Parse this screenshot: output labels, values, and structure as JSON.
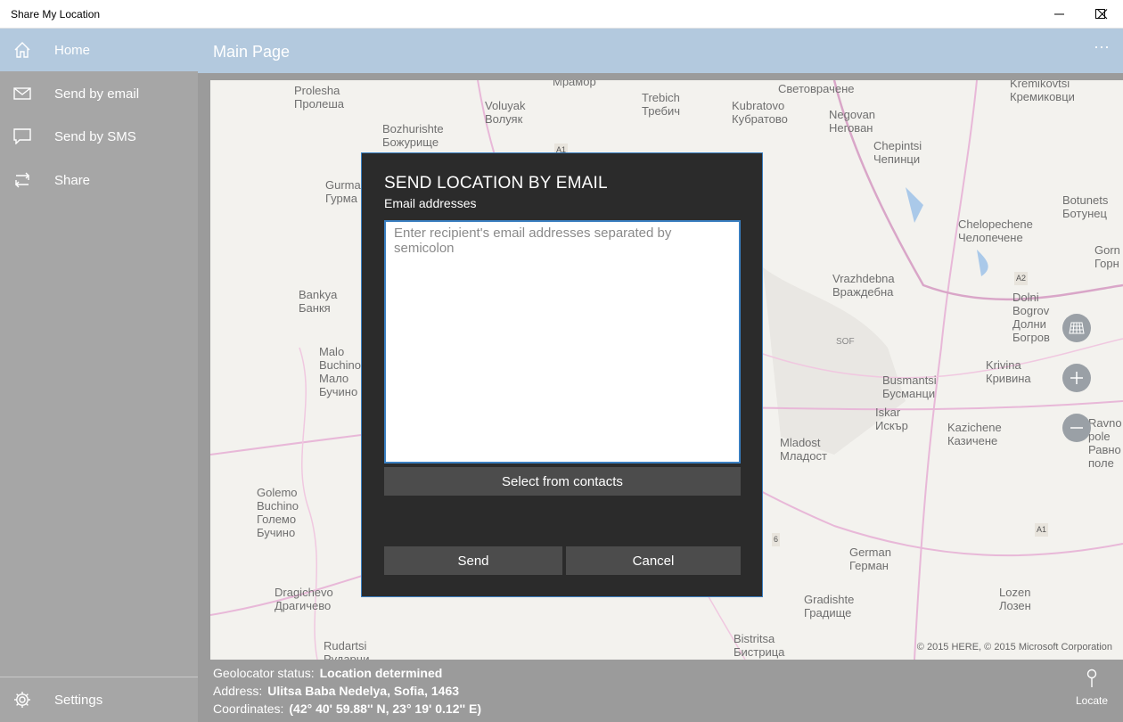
{
  "window": {
    "title": "Share My Location",
    "controls": [
      "minimize-icon",
      "maximize-icon",
      "close-icon"
    ]
  },
  "sidebar": {
    "items": [
      {
        "label": "Home",
        "icon": "home-icon",
        "active": true
      },
      {
        "label": "Send by email",
        "icon": "mail-icon",
        "active": false
      },
      {
        "label": "Send by SMS",
        "icon": "chat-icon",
        "active": false
      },
      {
        "label": "Share",
        "icon": "share-icon",
        "active": false
      }
    ],
    "settings": {
      "label": "Settings",
      "icon": "gear-icon"
    }
  },
  "header": {
    "title": "Main Page",
    "more_label": "···"
  },
  "map": {
    "places": [
      {
        "latin": "Prolesha",
        "cyrillic": "Пролеша"
      },
      {
        "latin": "",
        "cyrillic": "Мрамор"
      },
      {
        "latin": "Voluyak",
        "cyrillic": "Волуяк"
      },
      {
        "latin": "Trebich",
        "cyrillic": "Требич"
      },
      {
        "latin": "Kubratovo",
        "cyrillic": "Кубратово"
      },
      {
        "latin": "",
        "cyrillic": "Световрачене"
      },
      {
        "latin": "Kremikovtsi",
        "cyrillic": "Кремиковци"
      },
      {
        "latin": "Bozhurishte",
        "cyrillic": "Божурище"
      },
      {
        "latin": "Negovan",
        "cyrillic": "Негован"
      },
      {
        "latin": "Chepintsi",
        "cyrillic": "Чепинци"
      },
      {
        "latin": "Gurma",
        "cyrillic": "Гурма"
      },
      {
        "latin": "Botunets",
        "cyrillic": "Ботунец"
      },
      {
        "latin": "Chelopechene",
        "cyrillic": "Челопечене"
      },
      {
        "latin": "Gorn",
        "cyrillic": "Горн"
      },
      {
        "latin": "Bankya",
        "cyrillic": "Банкя"
      },
      {
        "latin": "Vrazhdebna",
        "cyrillic": "Враждебна"
      },
      {
        "latin": "Dolni Bogrov",
        "cyrillic": "Долни Богров"
      },
      {
        "latin": "Malo Buchino",
        "cyrillic": "Мало Бучино"
      },
      {
        "latin": "Busmantsi",
        "cyrillic": "Бусманци"
      },
      {
        "latin": "Krivina",
        "cyrillic": "Кривина"
      },
      {
        "latin": "Iskar",
        "cyrillic": "Искър"
      },
      {
        "latin": "Kazichene",
        "cyrillic": "Казичене"
      },
      {
        "latin": "Ravno pole",
        "cyrillic": "Равно поле"
      },
      {
        "latin": "Mladost",
        "cyrillic": "Младост"
      },
      {
        "latin": "Golemo Buchino",
        "cyrillic": "Големо Бучино"
      },
      {
        "latin": "German",
        "cyrillic": "Герман"
      },
      {
        "latin": "Dragichevo",
        "cyrillic": "Драгичево"
      },
      {
        "latin": "Gradishte",
        "cyrillic": "Градище"
      },
      {
        "latin": "Lozen",
        "cyrillic": "Лозен"
      },
      {
        "latin": "Rudartsi",
        "cyrillic": "Рударци"
      },
      {
        "latin": "Bistritsa",
        "cyrillic": "Бистрица"
      }
    ],
    "road_labels": [
      "A1",
      "A2",
      "A1",
      "6",
      "SOF"
    ],
    "controls": [
      "map-style-icon",
      "zoom-in-icon",
      "zoom-out-icon"
    ],
    "copyright": "© 2015 HERE, © 2015 Microsoft Corporation"
  },
  "status": {
    "geolocator_label": "Geolocator status:",
    "geolocator_value": "Location determined",
    "address_label": "Address:",
    "address_value": "Ulitsa Baba Nedelya, Sofia, 1463",
    "coordinates_label": "Coordinates:",
    "coordinates_value": "(42° 40' 59.88'' N, 23° 19' 0.12'' E)",
    "locate_label": "Locate"
  },
  "dialog": {
    "title": "SEND LOCATION BY EMAIL",
    "field_label": "Email addresses",
    "field_value": "",
    "field_placeholder": "Enter recipient's email addresses separated by semicolon",
    "select_contacts_label": "Select from contacts",
    "send_label": "Send",
    "cancel_label": "Cancel"
  },
  "colors": {
    "accent": "#3a7fc1",
    "header_bg": "#b3c9de",
    "sidebar_bg": "#a6a6a6",
    "dialog_bg": "#2b2b2b",
    "dialog_button_bg": "#4c4c4c"
  }
}
